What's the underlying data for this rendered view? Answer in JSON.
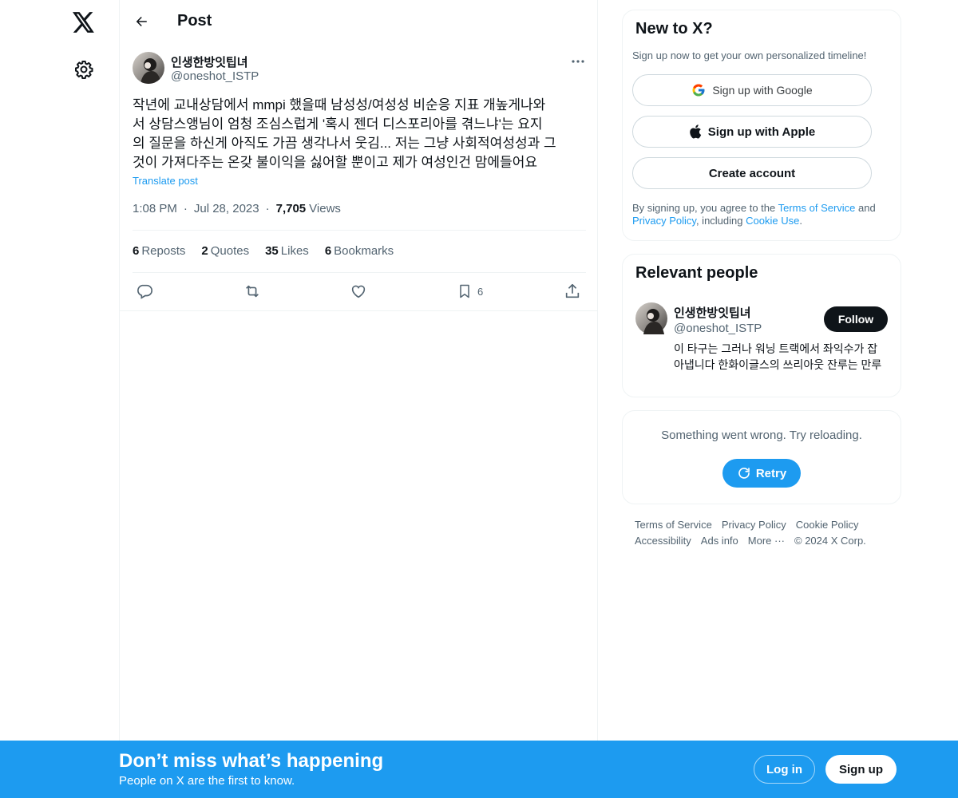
{
  "nav": {
    "logo_icon": "x-logo-icon",
    "settings_icon": "gear-icon"
  },
  "header": {
    "back_icon": "arrow-left-icon",
    "title": "Post"
  },
  "post": {
    "author_name": "인생한방잇팁녀",
    "author_handle": "@oneshot_ISTP",
    "text": "작년에 교내상담에서 mmpi 했을때 남성성/여성성 비순응 지표 개높게나와\n서 상담스앵님이 엄청 조심스럽게 '혹시 젠더 디스포리아를 겪느냐'는 요지\n의 질문을 하신게 아직도 가끔 생각나서 웃김... 저는 그냥 사회적여성성과 그\n것이 가져다주는 온갖 불이익을 싫어할 뿐이고 제가 여성인건 맘에들어요",
    "translate_label": "Translate post",
    "time": "1:08 PM",
    "date": "Jul 28, 2023",
    "views_count": "7,705",
    "views_label": "Views",
    "stats": {
      "reposts_count": "6",
      "reposts_label": "Reposts",
      "quotes_count": "2",
      "quotes_label": "Quotes",
      "likes_count": "35",
      "likes_label": "Likes",
      "bookmarks_count": "6",
      "bookmarks_label": "Bookmarks"
    },
    "actions": {
      "bookmark_count": "6"
    }
  },
  "signup_card": {
    "title": "New to X?",
    "subtitle": "Sign up now to get your own personalized timeline!",
    "google_label": "Sign up with Google",
    "apple_label": "Sign up with Apple",
    "create_label": "Create account",
    "legal_prefix": "By signing up, you agree to the ",
    "terms_link": "Terms of Service",
    "legal_and": " and ",
    "privacy_link": "Privacy Policy",
    "legal_including": ", including ",
    "cookie_link": "Cookie Use",
    "legal_end": "."
  },
  "relevant_people": {
    "title": "Relevant people",
    "name": "인생한방잇팁녀",
    "handle": "@oneshot_ISTP",
    "follow_label": "Follow",
    "bio": "이 타구는 그러나 워닝 트랙에서 좌익수가 잡아냅니다 한화이글스의 쓰리아웃 잔루는 만루"
  },
  "error_card": {
    "message": "Something went wrong. Try reloading.",
    "retry_label": "Retry"
  },
  "footer": {
    "terms": "Terms of Service",
    "privacy": "Privacy Policy",
    "cookie": "Cookie Policy",
    "accessibility": "Accessibility",
    "ads": "Ads info",
    "more": "More ···",
    "copyright": "© 2024 X Corp."
  },
  "bottom_bar": {
    "title": "Don’t miss what’s happening",
    "subtitle": "People on X are the first to know.",
    "login_label": "Log in",
    "signup_label": "Sign up"
  },
  "colors": {
    "accent": "#1d9bf0",
    "text": "#0f1419",
    "secondary": "#536471",
    "border": "#eff3f4"
  }
}
